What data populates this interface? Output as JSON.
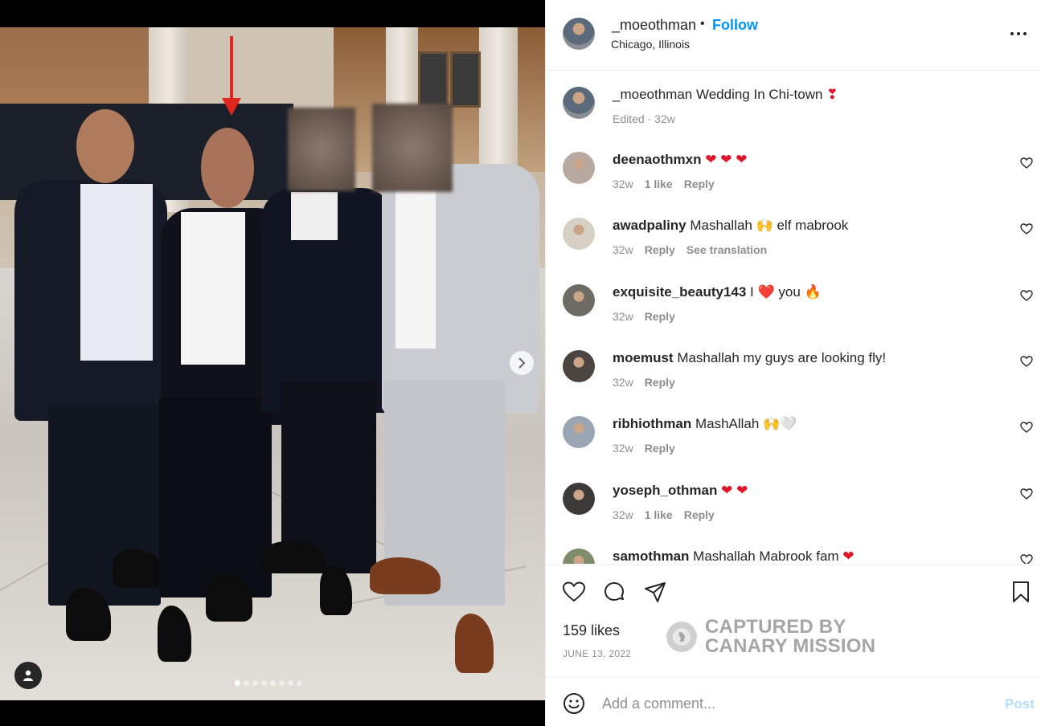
{
  "post": {
    "username": "_moeothman",
    "separator": "•",
    "follow_label": "Follow",
    "location": "Chicago, Illinois",
    "caption_username": "_moeothman",
    "caption_text": "Wedding In Chi-town",
    "caption_meta": "Edited · 32w",
    "likes": "159 likes",
    "date": "JUNE 13, 2022"
  },
  "comments": [
    {
      "username": "deenaothmxn",
      "text": "",
      "hearts": 3,
      "age": "32w",
      "likes": "1 like",
      "reply": "Reply",
      "translate": ""
    },
    {
      "username": "awadpaliny",
      "text": "Mashallah 🙌 elf mabrook",
      "hearts": 0,
      "age": "32w",
      "likes": "",
      "reply": "Reply",
      "translate": "See translation"
    },
    {
      "username": "exquisite_beauty143",
      "text": "I ❤️ you 🔥",
      "hearts": 0,
      "age": "32w",
      "likes": "",
      "reply": "Reply",
      "translate": ""
    },
    {
      "username": "moemust",
      "text": "Mashallah my guys are looking fly!",
      "hearts": 0,
      "age": "32w",
      "likes": "",
      "reply": "Reply",
      "translate": ""
    },
    {
      "username": "ribhiothman",
      "text": "MashAllah 🙌🤍",
      "hearts": 0,
      "age": "32w",
      "likes": "",
      "reply": "Reply",
      "translate": ""
    },
    {
      "username": "yoseph_othman",
      "text": "",
      "hearts": 2,
      "age": "32w",
      "likes": "1 like",
      "reply": "Reply",
      "translate": ""
    },
    {
      "username": "samothman",
      "text": "Mashallah Mabrook fam",
      "hearts": 1,
      "age": "",
      "likes": "",
      "reply": "",
      "translate": ""
    }
  ],
  "input": {
    "placeholder": "Add a comment...",
    "post_label": "Post"
  },
  "watermark": {
    "line1": "CAPTURED BY",
    "line2": "CANARY MISSION"
  },
  "carousel": {
    "count": 8,
    "active": 0
  },
  "colors": {
    "accent": "#0095f6",
    "arrow": "#e0271f",
    "heart": "#e0152b"
  }
}
